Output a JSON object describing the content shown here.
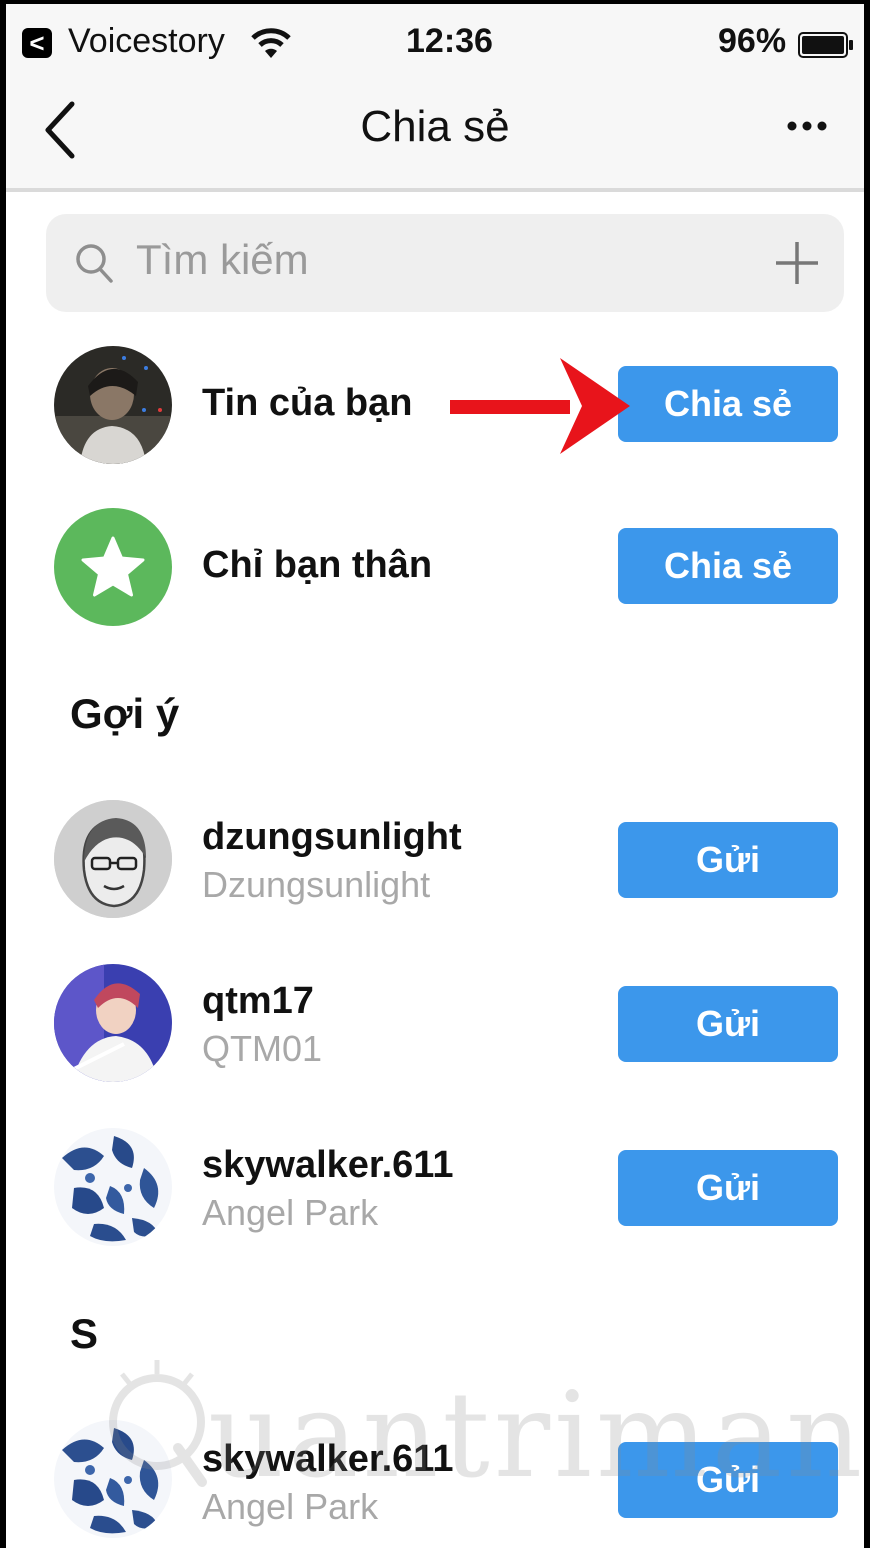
{
  "status_bar": {
    "back_glyph": "<",
    "carrier": "Voicestory",
    "time": "12:36",
    "battery": "96%"
  },
  "nav": {
    "title": "Chia sẻ"
  },
  "search": {
    "placeholder": "Tìm kiếm"
  },
  "story_rows": [
    {
      "title": "Tin của bạn",
      "button": "Chia sẻ"
    },
    {
      "title": "Chỉ bạn thân",
      "button": "Chia sẻ"
    }
  ],
  "suggestions": {
    "heading": "Gợi ý",
    "items": [
      {
        "username": "dzungsunlight",
        "name": "Dzungsunlight",
        "button": "Gửi"
      },
      {
        "username": "qtm17",
        "name": "QTM01",
        "button": "Gửi"
      },
      {
        "username": "skywalker.611",
        "name": "Angel Park",
        "button": "Gửi"
      }
    ]
  },
  "s_section": {
    "heading": "S",
    "items": [
      {
        "username": "skywalker.611",
        "name": "Angel Park",
        "button": "Gửi"
      }
    ]
  },
  "watermark": {
    "text": "uantrimang"
  },
  "colors": {
    "button_blue": "#3c97eb",
    "close_friends_green": "#5cb85c",
    "arrow_red": "#e8141b"
  }
}
